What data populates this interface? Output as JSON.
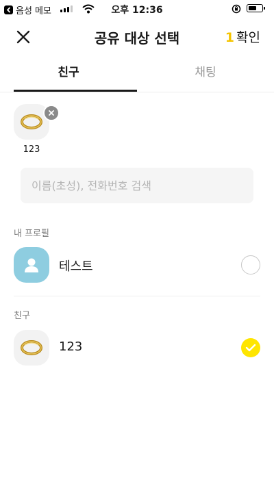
{
  "status_bar": {
    "back_app": "음성 메모",
    "time": "오후 12:36"
  },
  "header": {
    "title": "공유 대상 선택",
    "confirm_count": "1",
    "confirm_label": "확인"
  },
  "tabs": [
    {
      "label": "친구",
      "active": true
    },
    {
      "label": "채팅",
      "active": false
    }
  ],
  "selected": [
    {
      "name": "123"
    }
  ],
  "search": {
    "placeholder": "이름(초성), 전화번호 검색",
    "value": ""
  },
  "my_profile": {
    "section_label": "내 프로필",
    "name": "테스트",
    "checked": false
  },
  "friends": {
    "section_label": "친구",
    "items": [
      {
        "name": "123",
        "checked": true
      }
    ]
  },
  "colors": {
    "accent_yellow": "#fee500",
    "count_yellow": "#f5c400",
    "profile_bg": "#8ecde0"
  }
}
